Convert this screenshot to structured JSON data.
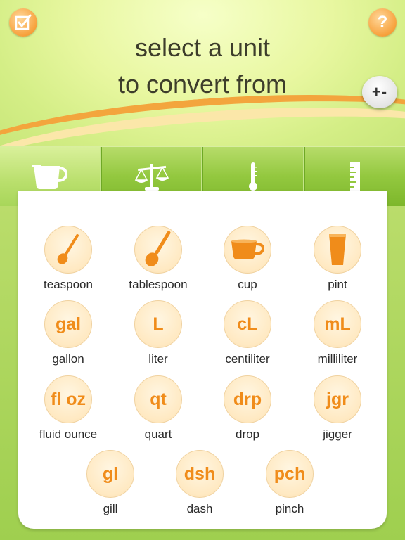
{
  "header": {
    "title_line1": "select a unit",
    "title_line2": "to convert from",
    "edit_icon": "checkbox-edit-icon",
    "help_label": "?",
    "plusminus_label": "+-"
  },
  "tabs": [
    {
      "name": "volume",
      "icon": "measuring-cup-icon",
      "active": true
    },
    {
      "name": "weight",
      "icon": "scale-icon",
      "active": false
    },
    {
      "name": "temperature",
      "icon": "thermometer-icon",
      "active": false
    },
    {
      "name": "length",
      "icon": "ruler-icon",
      "active": false
    }
  ],
  "units": [
    {
      "label": "teaspoon",
      "abbr": "",
      "icon": "teaspoon-icon"
    },
    {
      "label": "tablespoon",
      "abbr": "",
      "icon": "tablespoon-icon"
    },
    {
      "label": "cup",
      "abbr": "",
      "icon": "cup-icon"
    },
    {
      "label": "pint",
      "abbr": "",
      "icon": "pint-glass-icon"
    },
    {
      "label": "gallon",
      "abbr": "gal"
    },
    {
      "label": "liter",
      "abbr": "L"
    },
    {
      "label": "centiliter",
      "abbr": "cL"
    },
    {
      "label": "milliliter",
      "abbr": "mL"
    },
    {
      "label": "fluid ounce",
      "abbr": "fl oz"
    },
    {
      "label": "quart",
      "abbr": "qt"
    },
    {
      "label": "drop",
      "abbr": "drp"
    },
    {
      "label": "jigger",
      "abbr": "jgr"
    },
    {
      "label": "gill",
      "abbr": "gl"
    },
    {
      "label": "dash",
      "abbr": "dsh"
    },
    {
      "label": "pinch",
      "abbr": "pch"
    }
  ],
  "colors": {
    "accent": "#f08c1a",
    "green": "#93c83f",
    "circle": "#ffe9c2"
  }
}
